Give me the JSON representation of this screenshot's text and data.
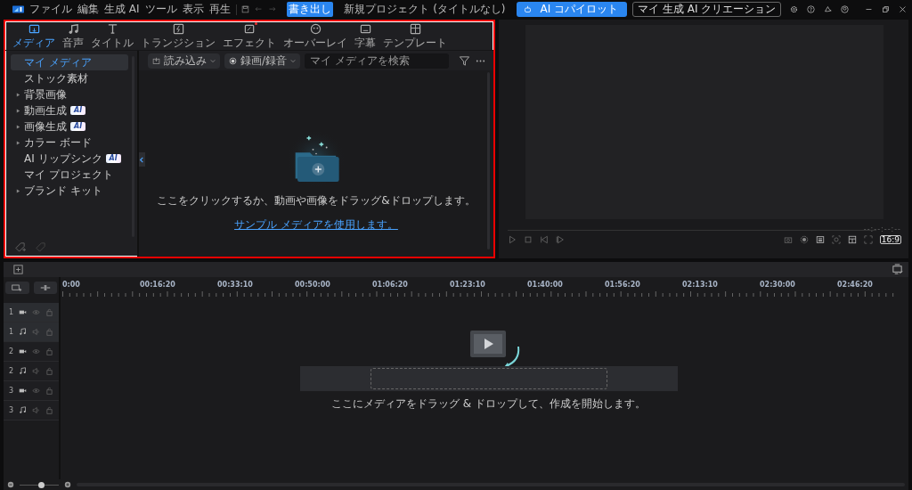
{
  "app_bar": {
    "menu": [
      "ファイル",
      "編集",
      "生成 AI",
      "ツール",
      "表示",
      "再生"
    ],
    "export_button": "書き出し",
    "project_title": "新規プロジェクト (タイトルなし)",
    "copilot_button": "AI コパイロット",
    "creations_button": "マイ 生成 AI クリエーション"
  },
  "highlight_frame": true,
  "media_tabs": [
    {
      "label": "メディア",
      "selected": true,
      "kind": "media",
      "dot": false
    },
    {
      "label": "音声",
      "selected": false,
      "kind": "audio",
      "dot": false
    },
    {
      "label": "タイトル",
      "selected": false,
      "kind": "title",
      "dot": false
    },
    {
      "label": "トランジション",
      "selected": false,
      "kind": "transition",
      "dot": false
    },
    {
      "label": "エフェクト",
      "selected": false,
      "kind": "effect",
      "dot": true
    },
    {
      "label": "オーバーレイ",
      "selected": false,
      "kind": "overlay",
      "dot": false
    },
    {
      "label": "字幕",
      "selected": false,
      "kind": "subtitle",
      "dot": false
    },
    {
      "label": "テンプレート",
      "selected": false,
      "kind": "template",
      "dot": false
    }
  ],
  "sidebar": {
    "items": [
      {
        "label": "マイ メディア",
        "selected": true,
        "expandable": false
      },
      {
        "label": "ストック素材",
        "selected": false,
        "expandable": false
      },
      {
        "label": "背景画像",
        "selected": false,
        "expandable": true
      },
      {
        "label": "動画生成",
        "selected": false,
        "expandable": true,
        "badge": "AI"
      },
      {
        "label": "画像生成",
        "selected": false,
        "expandable": true,
        "badge": "AI"
      },
      {
        "label": "カラー ボード",
        "selected": false,
        "expandable": true
      },
      {
        "label": "AI リップシンク",
        "selected": false,
        "expandable": false,
        "badge": "AI"
      },
      {
        "label": "マイ プロジェクト",
        "selected": false,
        "expandable": false
      },
      {
        "label": "ブランド キット",
        "selected": false,
        "expandable": true
      }
    ]
  },
  "media_toolbar": {
    "import_button": "読み込み",
    "record_button": "録画/録音",
    "search": {
      "placeholder": "マイ メディアを検索"
    }
  },
  "empty_state": {
    "message": "ここをクリックするか、動画や画像をドラッグ&ドロップします。",
    "link": "サンプル メディアを使用します。"
  },
  "preview": {
    "timecode": "--:--:--:--",
    "aspect_ratio": "16:9"
  },
  "timeline": {
    "ruler": [
      "0:00",
      "00:16:20",
      "00:33:10",
      "00:50:00",
      "01:06:20",
      "01:23:10",
      "01:40:00",
      "01:56:20",
      "02:13:10",
      "02:30:00",
      "02:46:20"
    ],
    "tracks": [
      {
        "number": "1",
        "kind": "video",
        "selected": true
      },
      {
        "number": "1",
        "kind": "audio",
        "selected": true
      },
      {
        "number": "2",
        "kind": "video",
        "selected": false
      },
      {
        "number": "2",
        "kind": "audio",
        "selected": false
      },
      {
        "number": "3",
        "kind": "video",
        "selected": false
      },
      {
        "number": "3",
        "kind": "audio",
        "selected": false
      }
    ],
    "drop_hint": "ここにメディアをドラッグ & ドロップして、作成を開始します。",
    "zoom": {
      "level": 0.55
    }
  }
}
